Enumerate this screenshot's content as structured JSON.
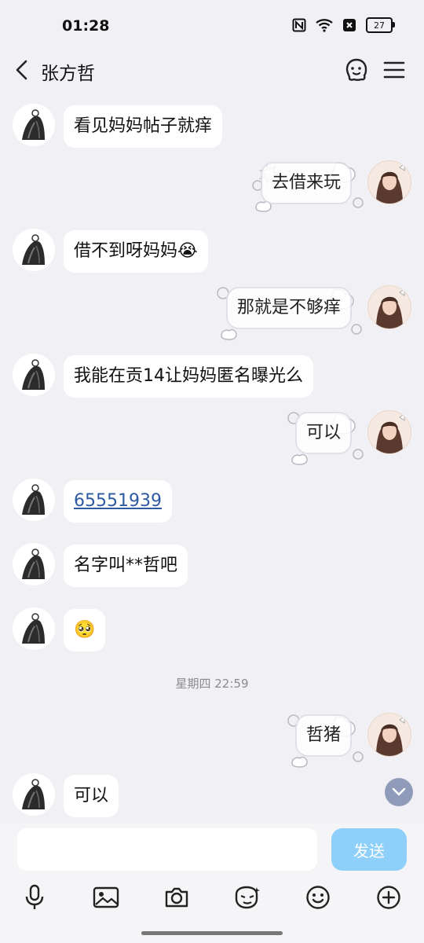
{
  "status_bar": {
    "time": "01:28",
    "battery": "27"
  },
  "header": {
    "title": "张方哲"
  },
  "messages": [
    {
      "side": "left",
      "text": "看见妈妈帖子就痒"
    },
    {
      "side": "right",
      "text": "去借来玩"
    },
    {
      "side": "left",
      "text": "借不到呀妈妈",
      "emoji": "😭"
    },
    {
      "side": "right",
      "text": "那就是不够痒"
    },
    {
      "side": "left",
      "text": "我能在贡14让妈妈匿名曝光么"
    },
    {
      "side": "right",
      "text": "可以"
    },
    {
      "side": "left",
      "text": "65551939",
      "is_link": true
    },
    {
      "side": "left",
      "text": "名字叫**哲吧"
    },
    {
      "side": "left",
      "emoji": "🥺"
    },
    {
      "side": "separator",
      "text": "星期四 22:59"
    },
    {
      "side": "right",
      "text": "哲猪"
    },
    {
      "side": "left",
      "text": "可以"
    }
  ],
  "input": {
    "placeholder": "",
    "send_label": "发送"
  },
  "toolbar": {
    "icons": [
      "microphone-icon",
      "image-icon",
      "camera-icon",
      "sticker-icon",
      "emoji-icon",
      "plus-icon"
    ]
  },
  "colors": {
    "background": "#f1f1f5",
    "send_button": "#8fd0fb",
    "link": "#2d5aa0"
  }
}
